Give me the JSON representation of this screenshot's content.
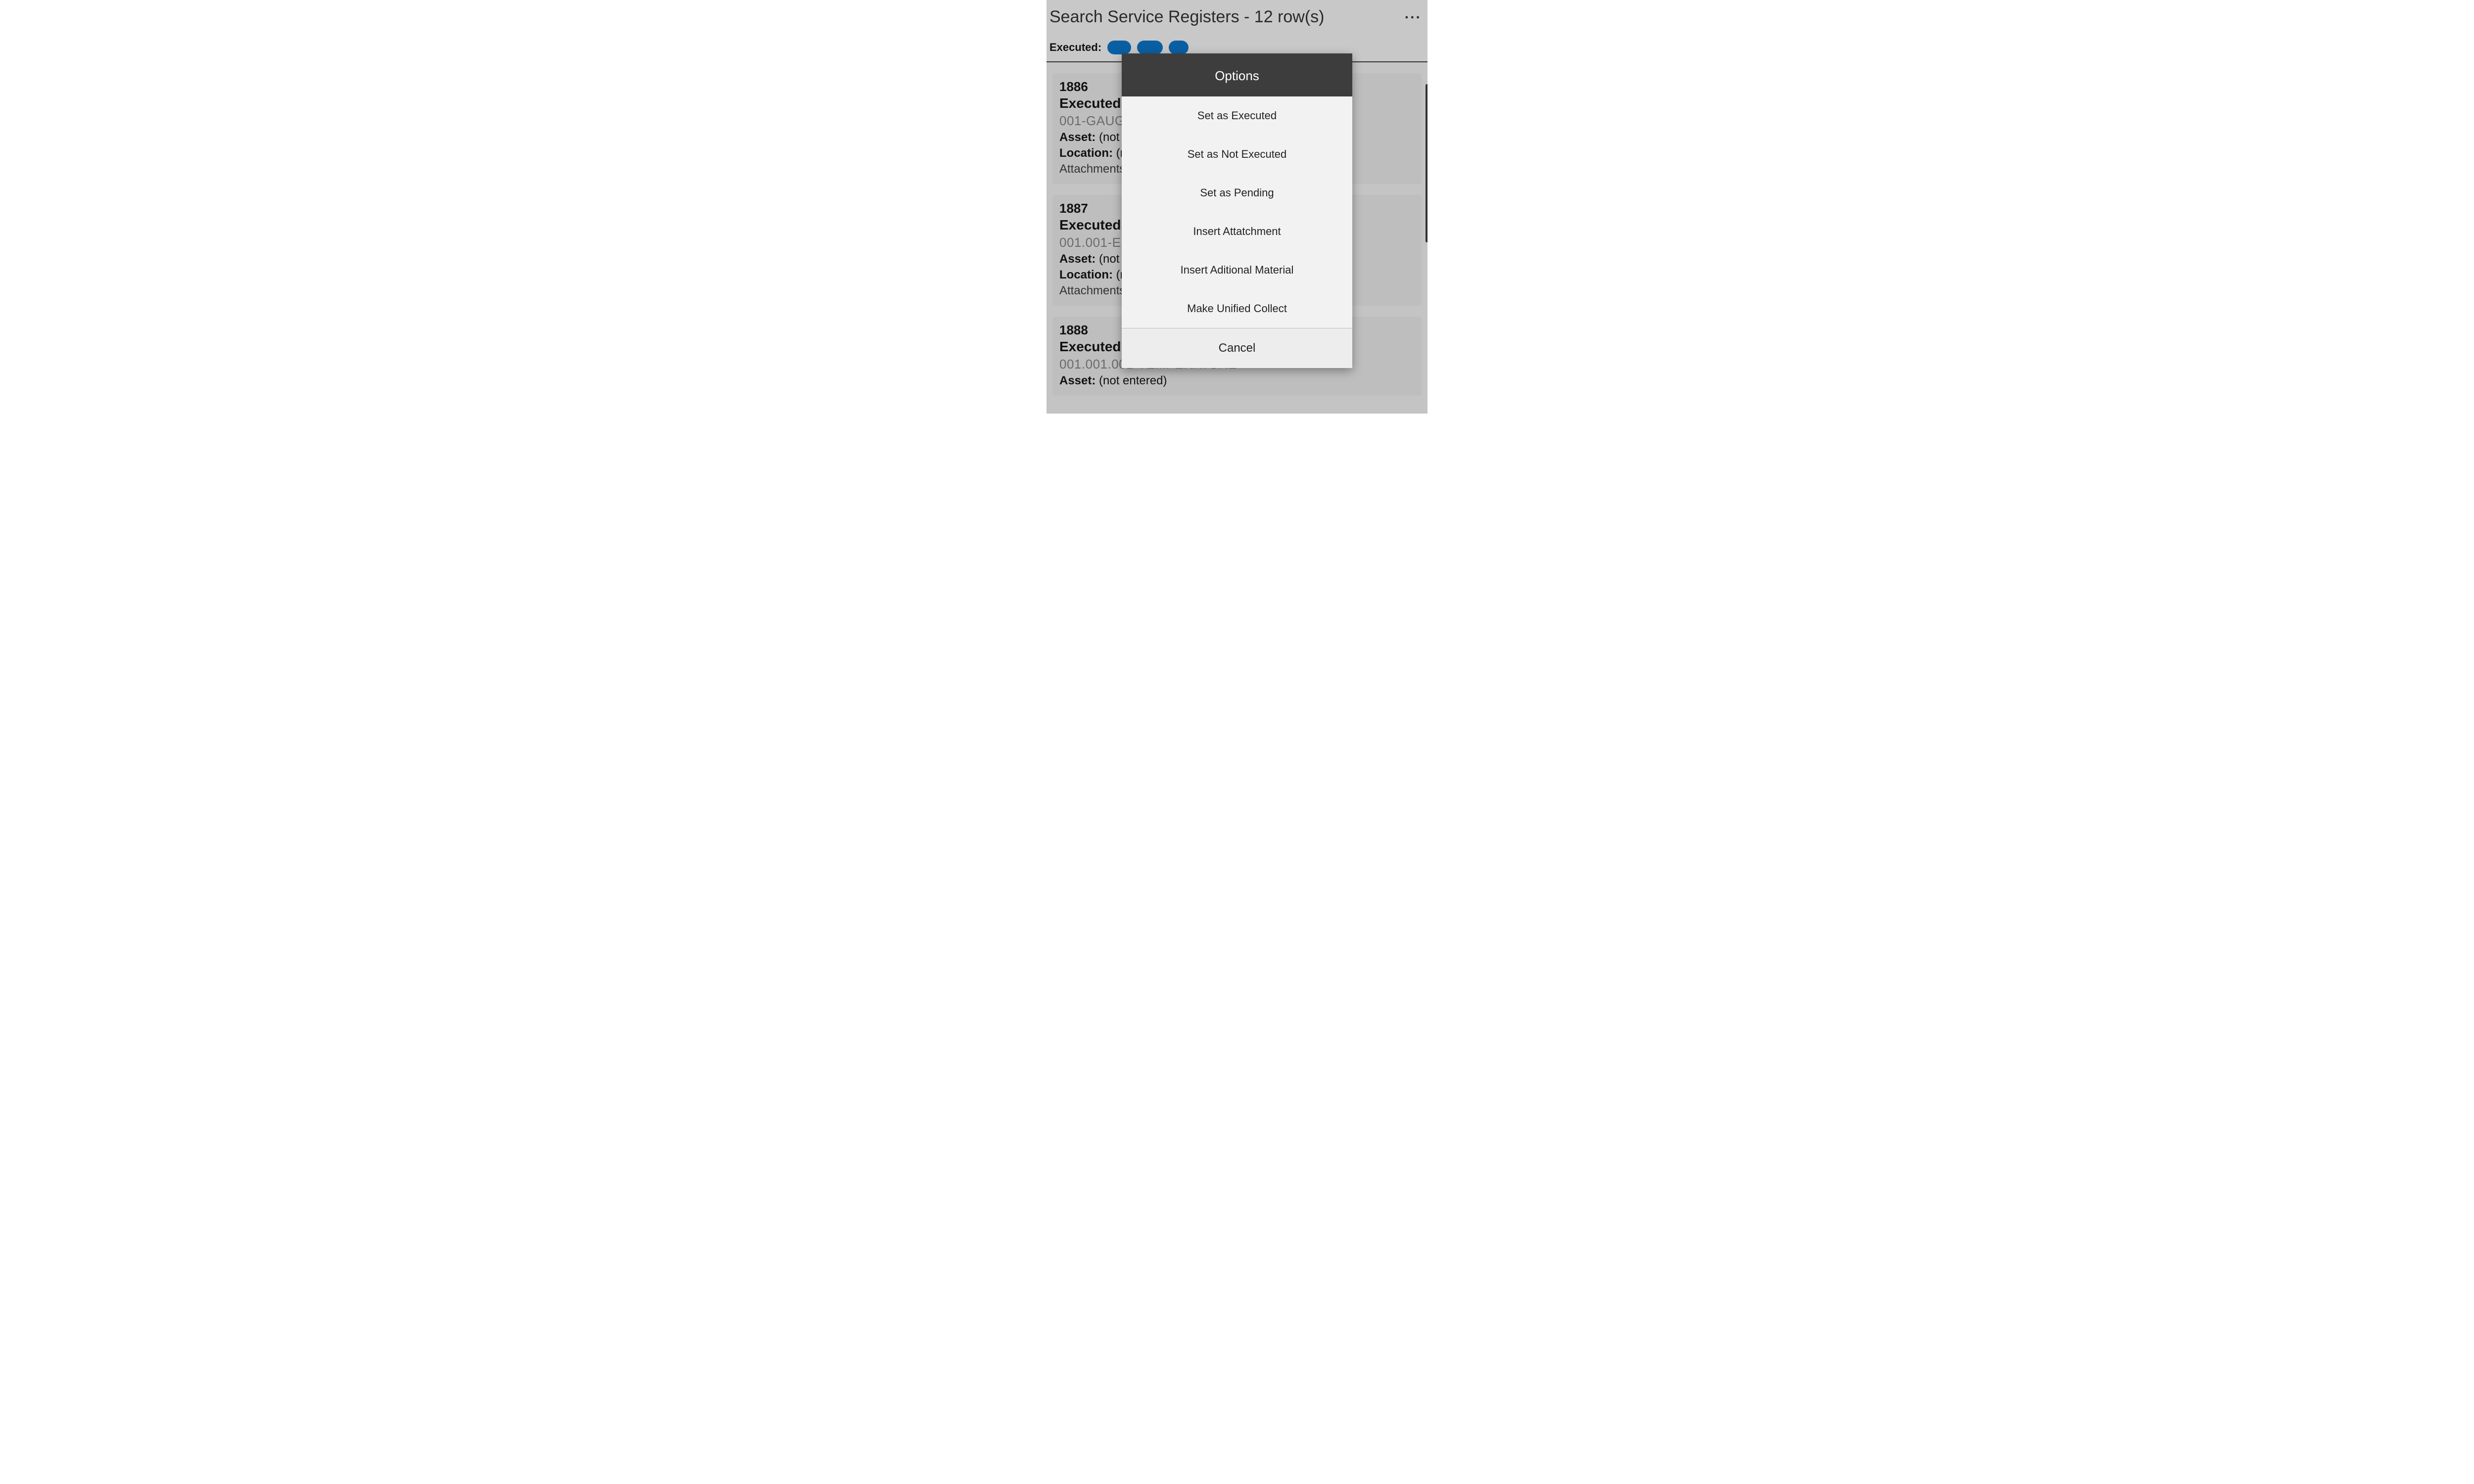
{
  "header": {
    "title": "Search Service Registers - 12 row(s)"
  },
  "filter": {
    "label": "Executed:"
  },
  "cards": [
    {
      "id": "1886",
      "exec": "Executed:",
      "code": "001-GAUG",
      "assetLabel": "Asset:",
      "assetVal": " (not e",
      "locLabel": "Location:",
      "locVal": " (n",
      "att": "Attachments"
    },
    {
      "id": "1887",
      "exec": "Executed:",
      "code": "001.001-EN",
      "assetLabel": "Asset:",
      "assetVal": " (not e",
      "locLabel": "Location:",
      "locVal": " (n",
      "att": "Attachments"
    },
    {
      "id": "1888",
      "exec": "Executed:",
      "code": "001.001.001-TEMPERATURE",
      "assetLabel": "Asset:",
      "assetVal": " (not entered)",
      "locLabel": "",
      "locVal": "",
      "att": ""
    }
  ],
  "modal": {
    "title": "Options",
    "items": [
      "Set as Executed",
      "Set as Not Executed",
      "Set as Pending",
      "Insert Attatchment",
      "Insert Aditional Material",
      "Make Unified Collect"
    ],
    "cancel": "Cancel"
  }
}
